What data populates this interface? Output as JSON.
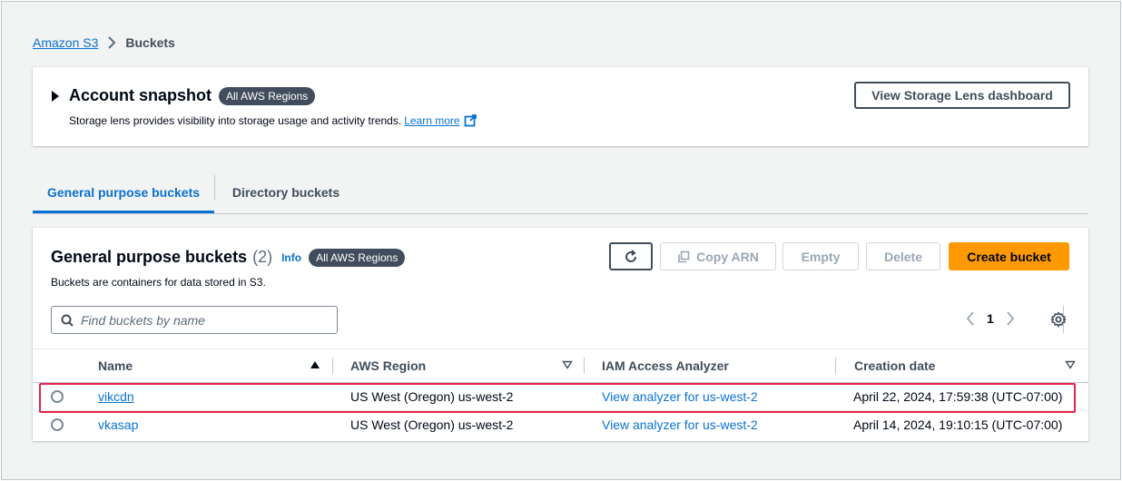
{
  "breadcrumb": {
    "root": "Amazon S3",
    "current": "Buckets"
  },
  "snapshot": {
    "title": "Account snapshot",
    "badge": "All AWS Regions",
    "description": "Storage lens provides visibility into storage usage and activity trends.",
    "learn_more": "Learn more",
    "dashboard_button": "View Storage Lens dashboard"
  },
  "tabs": [
    {
      "label": "General purpose buckets",
      "active": true
    },
    {
      "label": "Directory buckets",
      "active": false
    }
  ],
  "panel": {
    "title": "General purpose buckets",
    "count": "(2)",
    "info": "Info",
    "badge": "All AWS Regions",
    "description": "Buckets are containers for data stored in S3.",
    "buttons": {
      "copy_arn": "Copy ARN",
      "empty": "Empty",
      "delete": "Delete",
      "create": "Create bucket"
    },
    "search_placeholder": "Find buckets by name",
    "page": "1"
  },
  "table": {
    "columns": [
      "Name",
      "AWS Region",
      "IAM Access Analyzer",
      "Creation date"
    ],
    "rows": [
      {
        "name": "vikcdn",
        "region": "US West (Oregon) us-west-2",
        "iam": "View analyzer for us-west-2",
        "date": "April 22, 2024, 17:59:38 (UTC-07:00)",
        "highlighted": true
      },
      {
        "name": "vkasap",
        "region": "US West (Oregon) us-west-2",
        "iam": "View analyzer for us-west-2",
        "date": "April 14, 2024, 19:10:15 (UTC-07:00)",
        "highlighted": false
      }
    ]
  },
  "colors": {
    "link": "#0972d3",
    "primary": "#ff9900",
    "highlight": "#e5264a",
    "badge": "#414d5c"
  }
}
